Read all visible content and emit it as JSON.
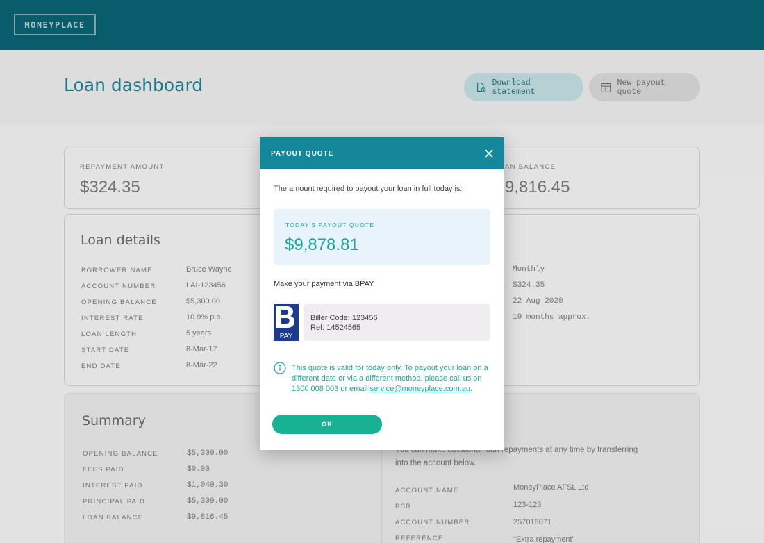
{
  "header": {
    "logo": "MONEYPLACE"
  },
  "page": {
    "title": "Loan dashboard",
    "download_label": "Download statement",
    "payout_label": "New payout quote"
  },
  "summary_bar": {
    "repayment_label": "REPAYMENT AMOUNT",
    "repayment_value": "$324.35",
    "balance_label": "AN BALANCE",
    "balance_value": "9,816.45"
  },
  "loan_details": {
    "title": "Loan details",
    "rows": [
      {
        "label": "BORROWER NAME",
        "value": "Bruce Wayne"
      },
      {
        "label": "ACCOUNT NUMBER",
        "value": "LAI-123456"
      },
      {
        "label": "OPENING BALANCE",
        "value": "$5,300.00"
      },
      {
        "label": "INTEREST RATE",
        "value": "10.9% p.a."
      },
      {
        "label": "LOAN LENGTH",
        "value": "5 years"
      },
      {
        "label": "START DATE",
        "value": "8-Mar-17"
      },
      {
        "label": "END DATE",
        "value": "8-Mar-22"
      }
    ],
    "right_values": [
      "Monthly",
      "$324.35",
      "22 Aug 2020",
      "19 months approx."
    ]
  },
  "summary": {
    "title": "Summary",
    "rows": [
      {
        "label": "OPENING BALANCE",
        "value": "$5,300.00"
      },
      {
        "label": "FEES PAID",
        "value": "$0.00"
      },
      {
        "label": "INTEREST PAID",
        "value": "$1,040.30"
      },
      {
        "label": "PRINCIPAL PAID",
        "value": "$5,300.00"
      },
      {
        "label": "LOAN BALANCE",
        "value": "$9,816.45"
      }
    ],
    "repay_text_1": "You can make additional loan repayments at any time by transferring",
    "repay_text_2": "into the account below.",
    "account_rows": [
      {
        "label": "ACCOUNT NAME",
        "value": "MoneyPlace AFSL Ltd"
      },
      {
        "label": "BSB",
        "value": "123-123"
      },
      {
        "label": "ACCOUNT NUMBER",
        "value": "257018071"
      },
      {
        "label": "REFERENCE",
        "value": "\"Extra repayment\""
      }
    ]
  },
  "modal": {
    "title": "PAYOUT QUOTE",
    "intro": "The amount required to payout your loan in full today is:",
    "quote_label": "TODAY'S PAYOUT QUOTE",
    "quote_amount": "$9,878.81",
    "bpay_heading": "Make your payment via BPAY",
    "biller_code": "Biller Code: 123456",
    "ref": "Ref: 14524565",
    "bpay_logo_text": "PAY",
    "notice_text": "This quote is valid for today only. To payout your loan on a different date or via a different method, please call us on 1300 008 003 or email ",
    "notice_email": "service@moneyplace.com.au",
    "notice_end": ".",
    "ok_label": "OK"
  },
  "colors": {
    "header": "#0a6070",
    "accent": "#14879a",
    "success": "#18b193",
    "bpay": "#1b3b8c"
  }
}
